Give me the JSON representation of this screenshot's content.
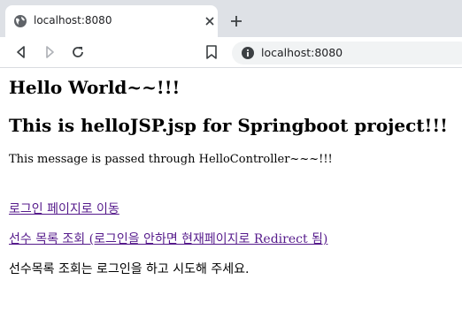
{
  "browser": {
    "tab": {
      "title": "localhost:8080"
    },
    "address_bar": {
      "url": "localhost:8080"
    },
    "icons": {
      "favicon": "globe-icon",
      "close": "close-icon",
      "new_tab": "plus-icon",
      "back": "back-arrow-icon",
      "forward": "forward-arrow-icon",
      "reload": "reload-icon",
      "bookmark": "bookmark-icon",
      "site_info": "info-icon"
    },
    "colors": {
      "tab_strip": "#dee1e6",
      "omnibox": "#f1f3f4",
      "visited_link": "#551a8b"
    }
  },
  "page": {
    "heading": "Hello World~~!!!",
    "subheading": "This is helloJSP.jsp for Springboot project!!!",
    "message": "This message is passed through HelloController~~~!!!",
    "links": [
      {
        "label": "로그인 페이지로 이동"
      },
      {
        "label": "선수 목록 조회 (로그인을 안하면 현재페이지로 Redirect 됨)"
      }
    ],
    "notice": "선수목록 조회는 로그인을 하고 시도해 주세요."
  }
}
